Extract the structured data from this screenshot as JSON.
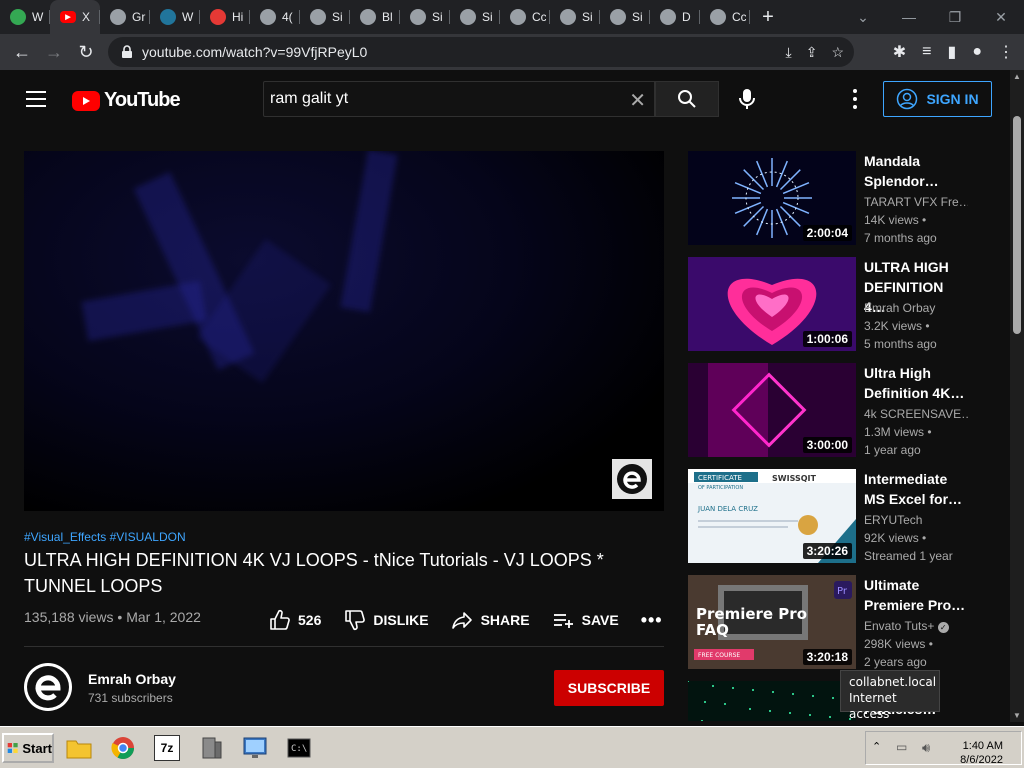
{
  "browser": {
    "tabs": [
      {
        "label": "W",
        "icon": "drive-icon",
        "color": "#34a853"
      },
      {
        "label": "X",
        "icon": "youtube-icon",
        "color": "#ff0000",
        "active": true
      },
      {
        "label": "Gr",
        "icon": "globe-icon",
        "color": "#9aa0a6"
      },
      {
        "label": "W",
        "icon": "wordpress-icon",
        "color": "#21759b"
      },
      {
        "label": "Hi",
        "icon": "red-icon",
        "color": "#e53935"
      },
      {
        "label": "4(",
        "icon": "globe-icon",
        "color": "#9aa0a6"
      },
      {
        "label": "Si",
        "icon": "globe-icon",
        "color": "#9aa0a6"
      },
      {
        "label": "Bl",
        "icon": "globe-icon",
        "color": "#9aa0a6"
      },
      {
        "label": "Si",
        "icon": "globe-icon",
        "color": "#9aa0a6"
      },
      {
        "label": "Si",
        "icon": "globe-icon",
        "color": "#9aa0a6"
      },
      {
        "label": "Cc",
        "icon": "github-icon",
        "color": "#9aa0a6"
      },
      {
        "label": "Si",
        "icon": "globe-icon",
        "color": "#9aa0a6"
      },
      {
        "label": "Si",
        "icon": "globe-icon",
        "color": "#9aa0a6"
      },
      {
        "label": "D",
        "icon": "download-icon",
        "color": "#9aa0a6"
      },
      {
        "label": "Cc",
        "icon": "github-icon",
        "color": "#9aa0a6"
      }
    ],
    "url": "youtube.com/watch?v=99VfjRPeyL0"
  },
  "youtube": {
    "logo_text": "YouTube",
    "search_query": "ram galit yt",
    "sign_in_label": "SIGN IN"
  },
  "video": {
    "hashtags": "#Visual_Effects #VISUALDON",
    "title": "ULTRA HIGH DEFINITION 4K VJ LOOPS - tNice Tutorials - VJ LOOPS * TUNNEL LOOPS",
    "views": "135,188 views",
    "date": "Mar 1, 2022",
    "likes": "526",
    "dislike_label": "DISLIKE",
    "share_label": "SHARE",
    "save_label": "SAVE",
    "channel": "Emrah Orbay",
    "subscribers": "731 subscribers",
    "subscribe_label": "SUBSCRIBE"
  },
  "recommendations": [
    {
      "title": "Mandala Splendor…",
      "channel": "TARART VFX Fre…",
      "views": "14K views",
      "age": "7 months ago",
      "duration": "2:00:04",
      "verified": false
    },
    {
      "title": "ULTRA HIGH DEFINITION 4…",
      "channel": "Emrah Orbay",
      "views": "3.2K views",
      "age": "5 months ago",
      "duration": "1:00:06",
      "verified": false
    },
    {
      "title": "Ultra High Definition 4K…",
      "channel": "4k SCREENSAVE…",
      "views": "1.3M views",
      "age": "1 year ago",
      "duration": "3:00:00",
      "verified": false
    },
    {
      "title": "Intermediate MS Excel for…",
      "channel": "ERYUTech",
      "views": "92K views",
      "age": "Streamed 1 year",
      "duration": "3:20:26",
      "verified": false
    },
    {
      "title": "Ultimate Premiere Pro…",
      "channel": "Envato Tuts+",
      "views": "298K views",
      "age": "2 years ago",
      "duration": "3:20:18",
      "verified": true
    },
    {
      "title": "Particles…",
      "channel": "",
      "views": "",
      "age": "",
      "duration": "",
      "verified": false
    }
  ],
  "thumbnails": {
    "cert_title": "CERTIFICATE",
    "cert_sub": "OF PARTICIPATION",
    "cert_name": "JUAN DELA CRUZ",
    "cert_brand": "SWISSQIT",
    "pp_text1": "Premiere Pro",
    "pp_text2": "FAQ",
    "pp_badge": "Pr",
    "pp_course": "FREE COURSE"
  },
  "tooltip": {
    "line1": "collabnet.local",
    "line2": "Internet access"
  },
  "taskbar": {
    "start_label": "Start",
    "time": "1:40 AM",
    "date": "8/6/2022"
  }
}
